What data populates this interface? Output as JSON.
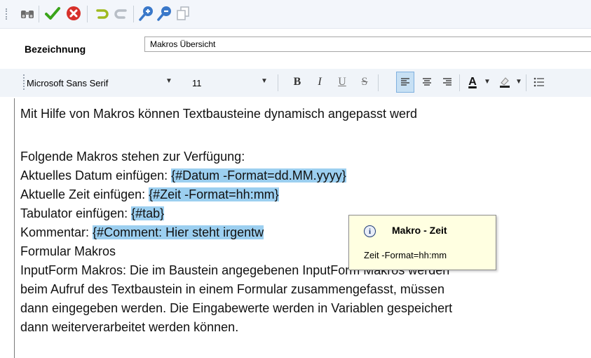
{
  "toolbar": {
    "buttons": [
      "binoculars-icon",
      "check-icon",
      "cancel-icon",
      "undo-icon",
      "redo-icon",
      "zoom-in-icon",
      "zoom-out-icon",
      "copy-icon"
    ]
  },
  "form": {
    "label": "Bezeichnung",
    "name_value": "Makros Übersicht"
  },
  "format_toolbar": {
    "font": "Microsoft Sans Serif",
    "size": "11",
    "bold": "B",
    "italic": "I",
    "underline": "U",
    "strike": "S",
    "font_color_glyph": "A"
  },
  "editor": {
    "lines": [
      {
        "text": "Mit Hilfe von Makros können Textbausteine dynamisch angepasst werd"
      },
      {
        "text": "Folgende Makros stehen zur Verfügung:"
      },
      {
        "prefix": "Aktuelles Datum einfügen: ",
        "macro": "{#Datum -Format=dd.MM.yyyy}"
      },
      {
        "prefix": "Aktuelle Zeit einfügen: ",
        "macro": "{#Zeit -Format=hh:mm}"
      },
      {
        "prefix": "Tabulator einfügen: ",
        "macro": "{#tab}"
      },
      {
        "prefix": "Kommentar: ",
        "macro": "{#Comment: Hier steht irgentw"
      },
      {
        "text": "Formular Makros"
      },
      {
        "text": "InputForm Makros: Die im Baustein angegebenen InputForm Makros werden"
      },
      {
        "text": "beim Aufruf des Textbaustein in einem Formular zusammengefasst, müssen"
      },
      {
        "text": "dann eingegeben werden. Die Eingabewerte werden in Variablen gespeichert"
      },
      {
        "text": "dann weiterverarbeitet werden können."
      }
    ]
  },
  "tooltip": {
    "title": "Makro - Zeit",
    "body": "Zeit -Format=hh:mm"
  },
  "colors": {
    "highlight": "#9ccff0",
    "tooltip_bg": "#ffffe1"
  }
}
